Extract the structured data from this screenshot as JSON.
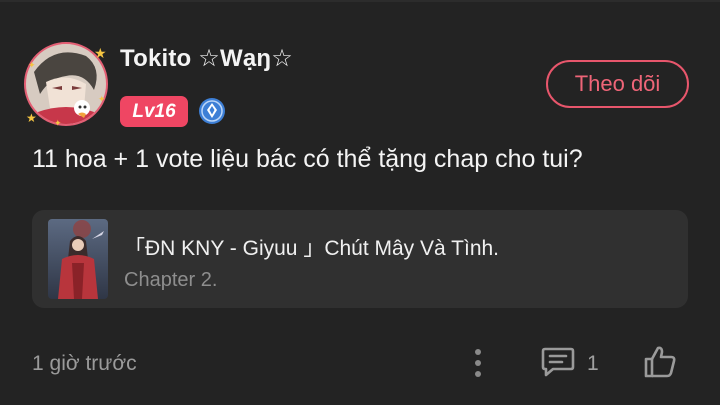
{
  "comment": {
    "author": {
      "name": "Tokito ☆Wạŋ☆",
      "level_badge": "Lv16",
      "avatar_icon": "anime-avatar-icon",
      "verified_icon": "blue-verified-badge-icon"
    },
    "follow_label": "Theo dõi",
    "text": "11 hoa + 1 vote liệu bác có thể tặng chap cho tui?",
    "story": {
      "title": "「ĐN KNY - Giyuu 」Chút Mây Và Tình.",
      "chapter": "Chapter 2.",
      "cover_icon": "story-cover-image"
    },
    "footer": {
      "time": "1 giờ trước",
      "reply_count": "1",
      "more_icon": "more-vertical-icon",
      "comment_icon": "comment-icon",
      "like_icon": "thumbs-up-icon"
    }
  },
  "colors": {
    "background": "#232323",
    "card": "#303030",
    "accent": "#ef4663",
    "verified_blue": "#3d7fd6",
    "muted_text": "#9a9a9a"
  }
}
